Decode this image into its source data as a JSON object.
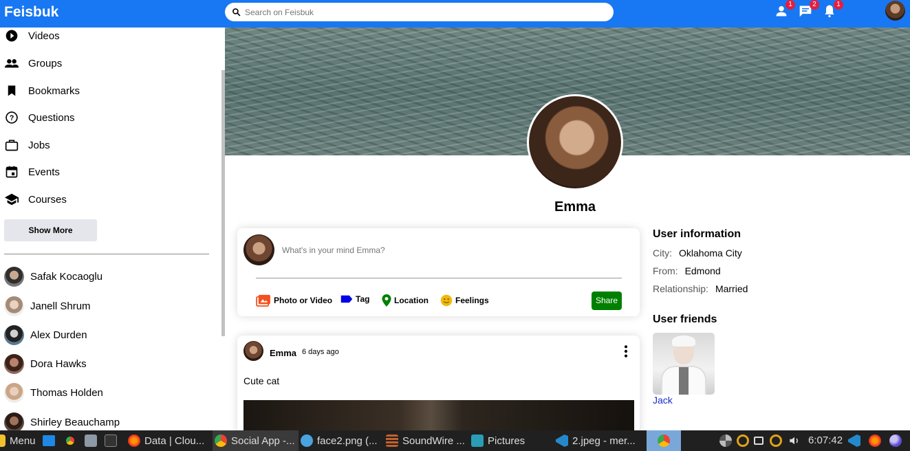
{
  "app": {
    "logo": "Feisbuk",
    "search_placeholder": "Search on Feisbuk",
    "badges": {
      "friends": "1",
      "messages": "2",
      "notifications": "1"
    },
    "accent": "#1877f2"
  },
  "sidebar": {
    "items": [
      {
        "label": "Videos",
        "icon": "play-circle-icon"
      },
      {
        "label": "Groups",
        "icon": "group-icon"
      },
      {
        "label": "Bookmarks",
        "icon": "bookmark-icon"
      },
      {
        "label": "Questions",
        "icon": "help-circle-icon"
      },
      {
        "label": "Jobs",
        "icon": "briefcase-icon"
      },
      {
        "label": "Events",
        "icon": "calendar-icon"
      },
      {
        "label": "Courses",
        "icon": "school-icon"
      }
    ],
    "show_more": "Show More",
    "friends": [
      "Safak Kocaoglu",
      "Janell Shrum",
      "Alex Durden",
      "Dora Hawks",
      "Thomas Holden",
      "Shirley Beauchamp"
    ]
  },
  "profile": {
    "name": "Emma"
  },
  "share": {
    "placeholder": "What's in your mind Emma?",
    "options": [
      "Photo or Video",
      "Tag",
      "Location",
      "Feelings"
    ],
    "button": "Share"
  },
  "post": {
    "user": "Emma",
    "time": "6 days ago",
    "text": "Cute cat"
  },
  "rightbar": {
    "info_title": "User information",
    "info": [
      {
        "key": "City:",
        "value": "Oklahoma City"
      },
      {
        "key": "From:",
        "value": "Edmond"
      },
      {
        "key": "Relationship:",
        "value": "Married"
      }
    ],
    "friends_title": "User friends",
    "friends": [
      {
        "name": "Jack"
      }
    ]
  },
  "taskbar": {
    "menu": "Menu",
    "items": [
      "Data | Clou...",
      "Social App -...",
      "face2.png (...",
      "SoundWire ...",
      "Pictures",
      "2.jpeg - mer..."
    ],
    "clock": "6:07:42"
  }
}
